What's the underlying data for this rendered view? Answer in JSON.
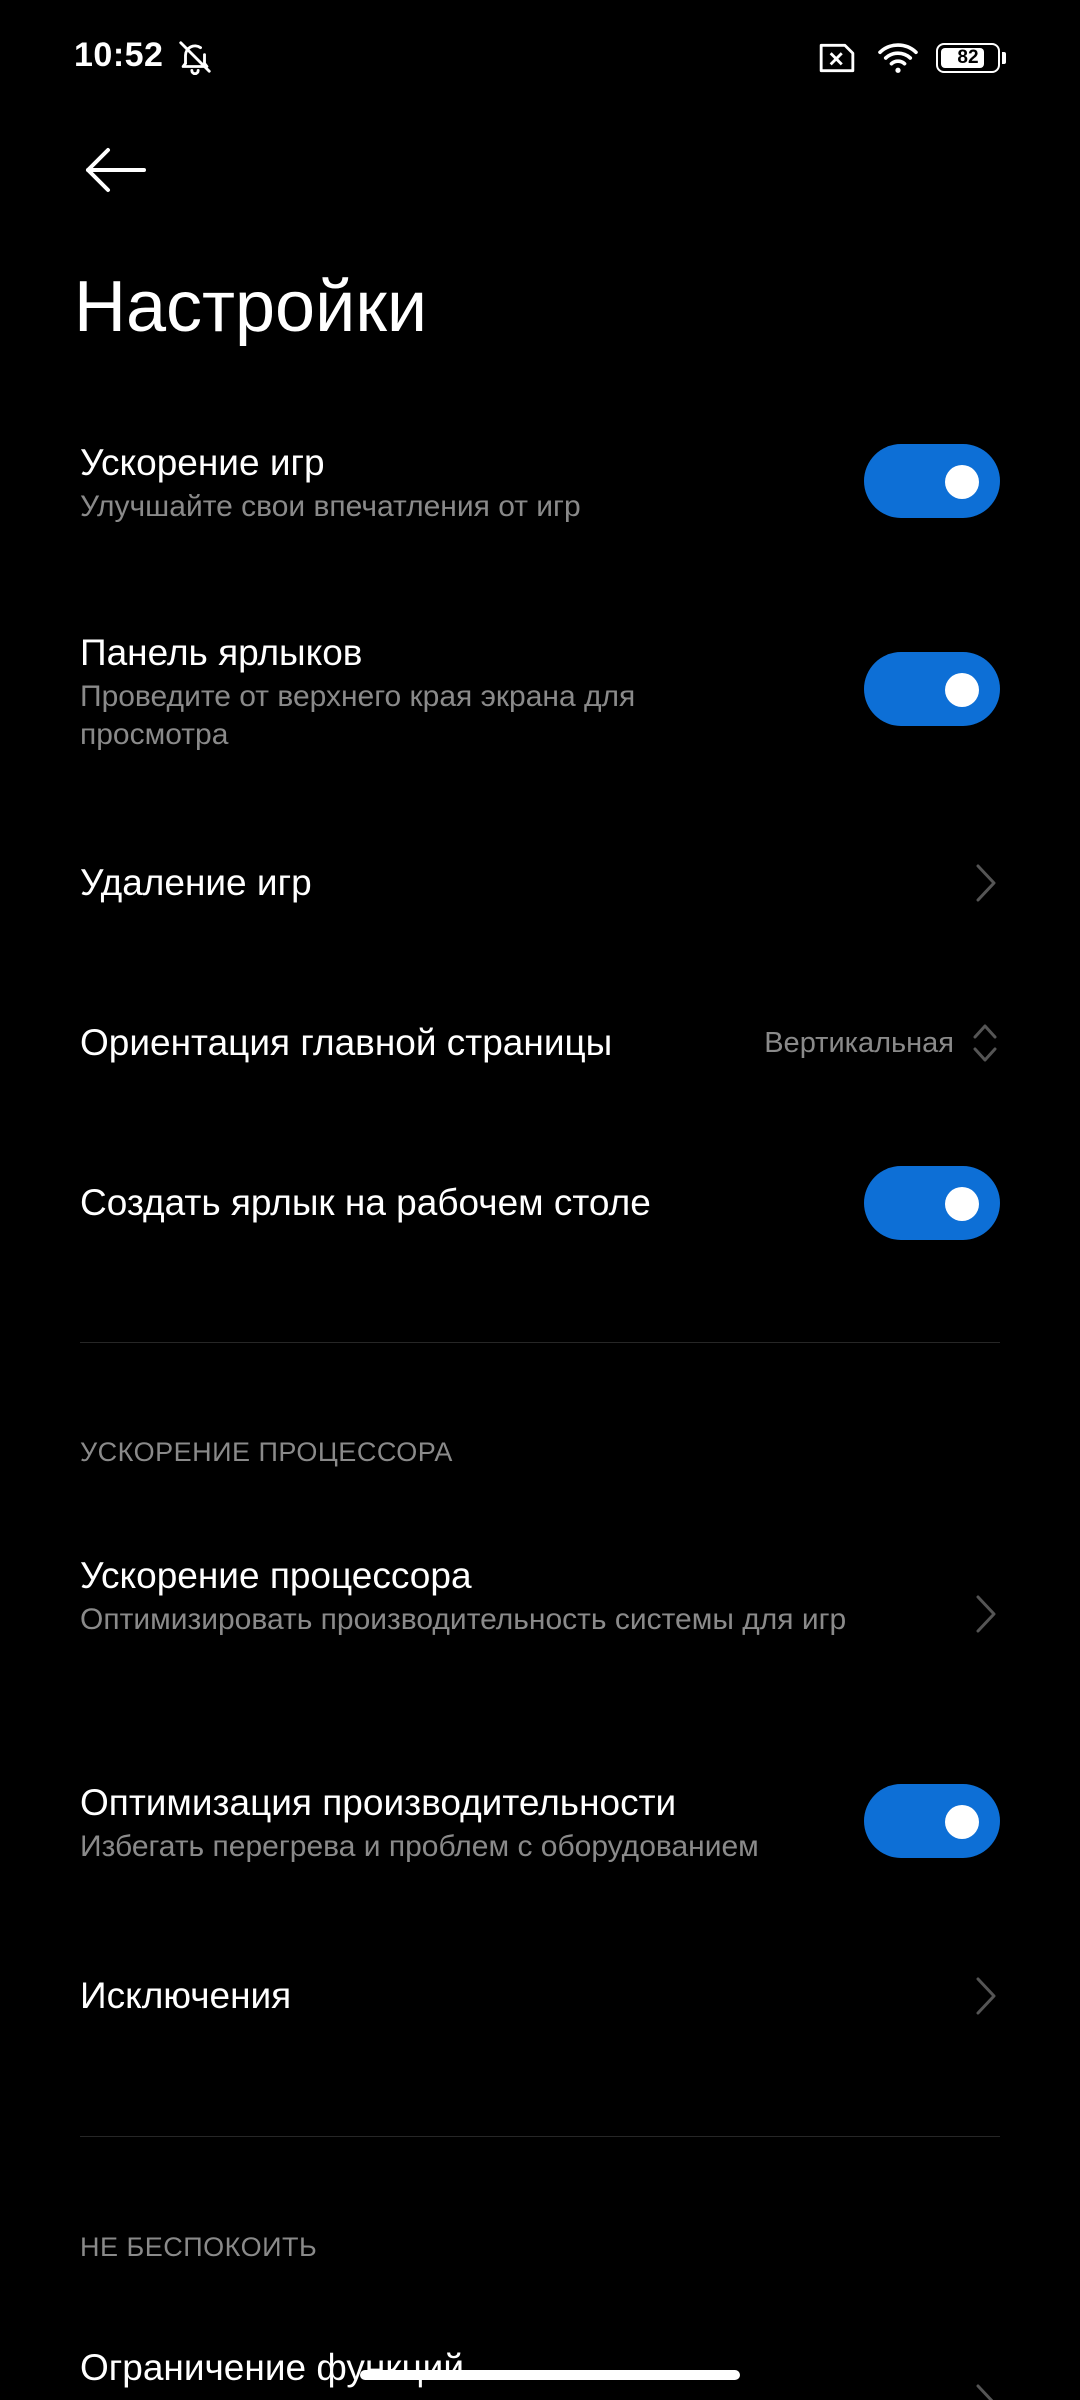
{
  "status_bar": {
    "time": "10:52",
    "battery_level": "82",
    "battery_fraction": 0.82,
    "icons": [
      "bell-off-icon",
      "sim-error-icon",
      "wifi-icon",
      "battery-icon"
    ]
  },
  "header": {
    "title": "Настройки",
    "back_icon": "arrow-left-icon"
  },
  "colors": {
    "background": "#000000",
    "accent": "#0d6fd6",
    "subtitle": "#8a8a8a",
    "divider": "#262626"
  },
  "settings": [
    {
      "title": "Ускорение игр",
      "subtitle": "Улучшайте свои впечатления от игр",
      "control": "toggle",
      "on": true
    },
    {
      "title": "Панель ярлыков",
      "subtitle": "Проведите от верхнего края экрана для просмотра",
      "control": "toggle",
      "on": true
    },
    {
      "title": "Удаление игр",
      "control": "chevron"
    },
    {
      "title": "Ориентация главной страницы",
      "value": "Вертикальная",
      "control": "dropdown"
    },
    {
      "title": "Создать ярлык на рабочем столе",
      "control": "toggle",
      "on": true
    }
  ],
  "section_cpu": {
    "header": "УСКОРЕНИЕ ПРОЦЕССОРА",
    "items": [
      {
        "title": "Ускорение процессора",
        "subtitle": "Оптимизировать производительность системы для игр",
        "control": "chevron"
      },
      {
        "title": "Оптимизация производительности",
        "subtitle": "Избегать перегрева и проблем с оборудованием",
        "control": "toggle",
        "on": true
      },
      {
        "title": "Исключения",
        "control": "chevron"
      }
    ]
  },
  "section_dnd": {
    "header": "НЕ БЕСПОКОИТЬ",
    "items": [
      {
        "title": "Ограничение функций",
        "control": "chevron"
      }
    ]
  }
}
